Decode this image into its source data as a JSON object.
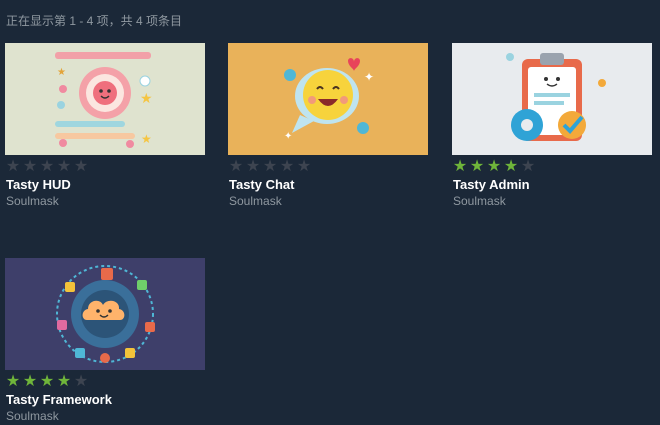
{
  "listing": {
    "count_text": "正在显示第 1 - 4 项，共 4 项条目"
  },
  "items": [
    {
      "title": "Tasty HUD",
      "author": "Soulmask",
      "rating": 0,
      "thumb_bg": "#dfe3cf",
      "thumb_icon": "hud-thumbnail-icon"
    },
    {
      "title": "Tasty Chat",
      "author": "Soulmask",
      "rating": 0,
      "thumb_bg": "#e9b25a",
      "thumb_icon": "chat-thumbnail-icon"
    },
    {
      "title": "Tasty Admin",
      "author": "Soulmask",
      "rating": 4,
      "thumb_bg": "#e8ebee",
      "thumb_icon": "admin-thumbnail-icon"
    },
    {
      "title": "Tasty Framework",
      "author": "Soulmask",
      "rating": 4,
      "thumb_bg": "#3e3f6a",
      "thumb_icon": "framework-thumbnail-icon"
    }
  ],
  "rating_max": 5,
  "colors": {
    "star_on": "#6fb53a",
    "star_off": "#3d4450",
    "background": "#1b2838"
  }
}
